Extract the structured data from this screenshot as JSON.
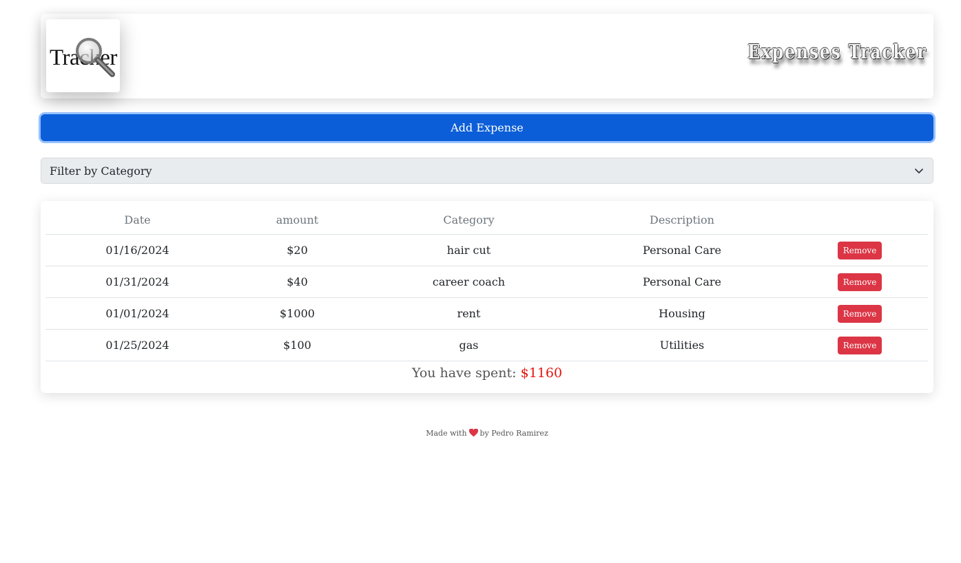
{
  "header": {
    "logo_text": "Tracker",
    "title": "Expenses Tracker"
  },
  "actions": {
    "add_expense_label": "Add Expense"
  },
  "filter": {
    "selected": "Filter by Category"
  },
  "table": {
    "columns": [
      "Date",
      "amount",
      "Category",
      "Description",
      ""
    ],
    "rows": [
      {
        "date": "01/16/2024",
        "amount": "$20",
        "category": "hair cut",
        "description": "Personal Care",
        "action": "Remove"
      },
      {
        "date": "01/31/2024",
        "amount": "$40",
        "category": "career coach",
        "description": "Personal Care",
        "action": "Remove"
      },
      {
        "date": "01/01/2024",
        "amount": "$1000",
        "category": "rent",
        "description": "Housing",
        "action": "Remove"
      },
      {
        "date": "01/25/2024",
        "amount": "$100",
        "category": "gas",
        "description": "Utilities",
        "action": "Remove"
      }
    ]
  },
  "summary": {
    "label": "You have spent:",
    "total": "$1160"
  },
  "footer": {
    "made_with": "Made with",
    "by_text": "by Pedro Ramirez"
  },
  "icons": {
    "logo": "magnifying-glass-icon",
    "filter": "chevron-down-icon",
    "footer": "heart-icon"
  },
  "colors": {
    "primary": "#0b5ed7",
    "danger": "#dc3545",
    "total": "#e4130e",
    "heart": "#dc3545"
  }
}
